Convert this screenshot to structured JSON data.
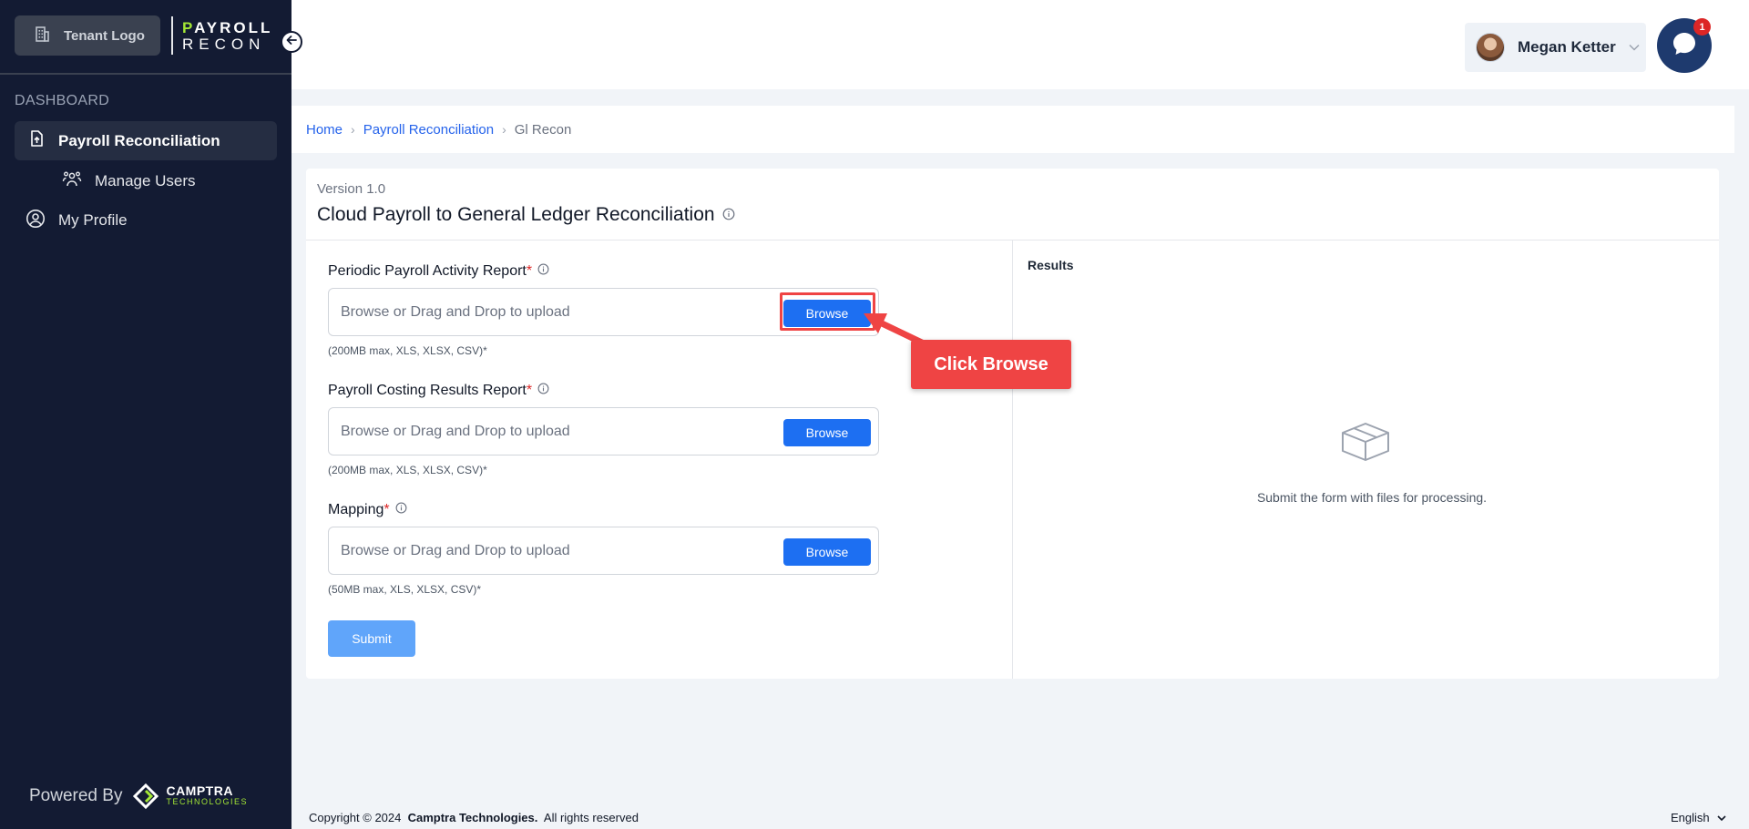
{
  "sidebar": {
    "tenant_logo": "Tenant Logo",
    "brand": {
      "line1_accent": "P",
      "line1_rest": "AYROLL",
      "line2": "RECON"
    },
    "section_label": "DASHBOARD",
    "items": [
      {
        "label": "Payroll Reconciliation",
        "icon": "file-upload-icon",
        "active": true
      },
      {
        "label": "Manage Users",
        "icon": "users-icon",
        "active": false
      },
      {
        "label": "My Profile",
        "icon": "user-circle-icon",
        "active": false
      }
    ],
    "powered_by": "Powered By",
    "camptra": {
      "name": "CAMPTRA",
      "sub": "TECHNOLOGIES"
    }
  },
  "header": {
    "user_name": "Megan Ketter",
    "chat_badge": "1"
  },
  "breadcrumb": {
    "items": [
      "Home",
      "Payroll Reconciliation"
    ],
    "current": "Gl Recon"
  },
  "card": {
    "version": "Version 1.0",
    "title": "Cloud Payroll to General Ledger Reconciliation",
    "fields": [
      {
        "label": "Periodic Payroll Activity Report",
        "required": "*",
        "placeholder": "Browse or Drag and Drop to upload",
        "button": "Browse",
        "hint": "(200MB max, XLS, XLSX, CSV)*"
      },
      {
        "label": "Payroll Costing Results Report",
        "required": "*",
        "placeholder": "Browse or Drag and Drop to upload",
        "button": "Browse",
        "hint": "(200MB max, XLS, XLSX, CSV)*"
      },
      {
        "label": "Mapping",
        "required": "*",
        "placeholder": "Browse or Drag and Drop to upload",
        "button": "Browse",
        "hint": "(50MB max, XLS, XLSX, CSV)*"
      }
    ],
    "submit_label": "Submit",
    "results_label": "Results",
    "empty_text": "Submit the form with files for processing."
  },
  "annotation": {
    "callout": "Click Browse"
  },
  "footer": {
    "copyright": "Copyright © 2024",
    "company": "Camptra Technologies.",
    "rights": "All rights reserved",
    "language": "English"
  },
  "colors": {
    "sidebar": "#131b33",
    "accent": "#1d6ff2",
    "brand_green": "#a3e635",
    "annotation": "#ef4444"
  }
}
